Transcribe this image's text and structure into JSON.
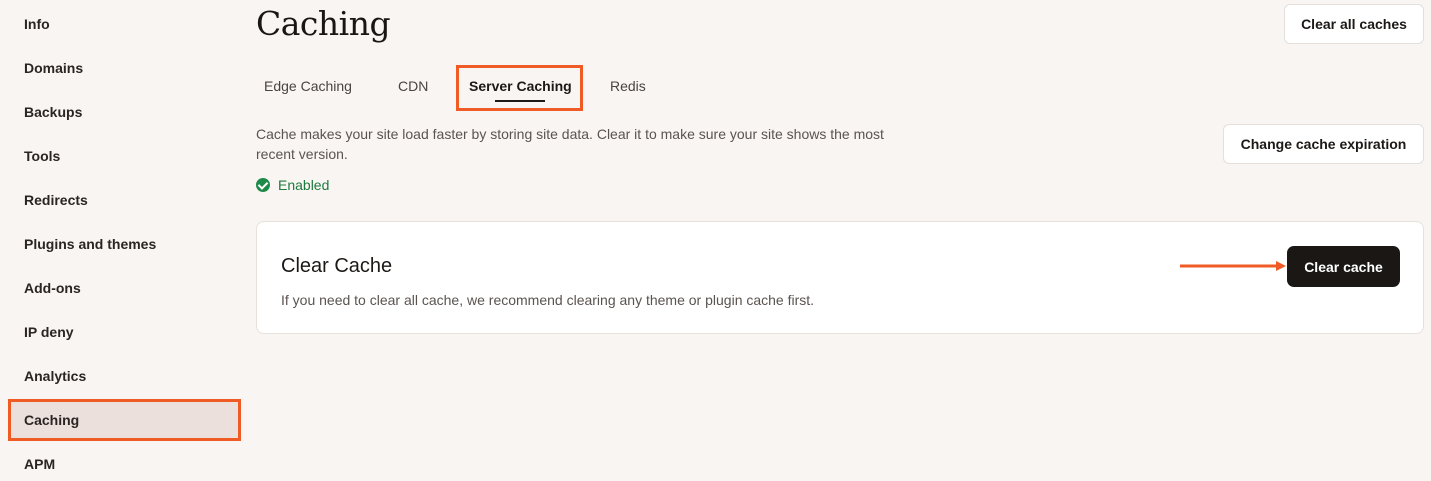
{
  "sidebar": {
    "items": [
      {
        "label": "Info"
      },
      {
        "label": "Domains"
      },
      {
        "label": "Backups"
      },
      {
        "label": "Tools"
      },
      {
        "label": "Redirects"
      },
      {
        "label": "Plugins and themes"
      },
      {
        "label": "Add-ons"
      },
      {
        "label": "IP deny"
      },
      {
        "label": "Analytics"
      },
      {
        "label": "Caching"
      },
      {
        "label": "APM"
      }
    ],
    "active": "Caching"
  },
  "header": {
    "title": "Caching",
    "clear_all_label": "Clear all caches"
  },
  "tabs": [
    {
      "label": "Edge Caching"
    },
    {
      "label": "CDN"
    },
    {
      "label": "Server Caching"
    },
    {
      "label": "Redis"
    }
  ],
  "active_tab": "Server Caching",
  "content": {
    "description": "Cache makes your site load faster by storing site data. Clear it to make sure your site shows the most recent version.",
    "change_expiration_label": "Change cache expiration",
    "status": "Enabled"
  },
  "card": {
    "title": "Clear Cache",
    "text": "If you need to clear all cache, we recommend clearing any theme or plugin cache first.",
    "button_label": "Clear cache"
  },
  "colors": {
    "highlight": "#f05a24",
    "status_green": "#1e8a4a",
    "primary_button": "#1a1715",
    "background": "#f8f5f2"
  }
}
